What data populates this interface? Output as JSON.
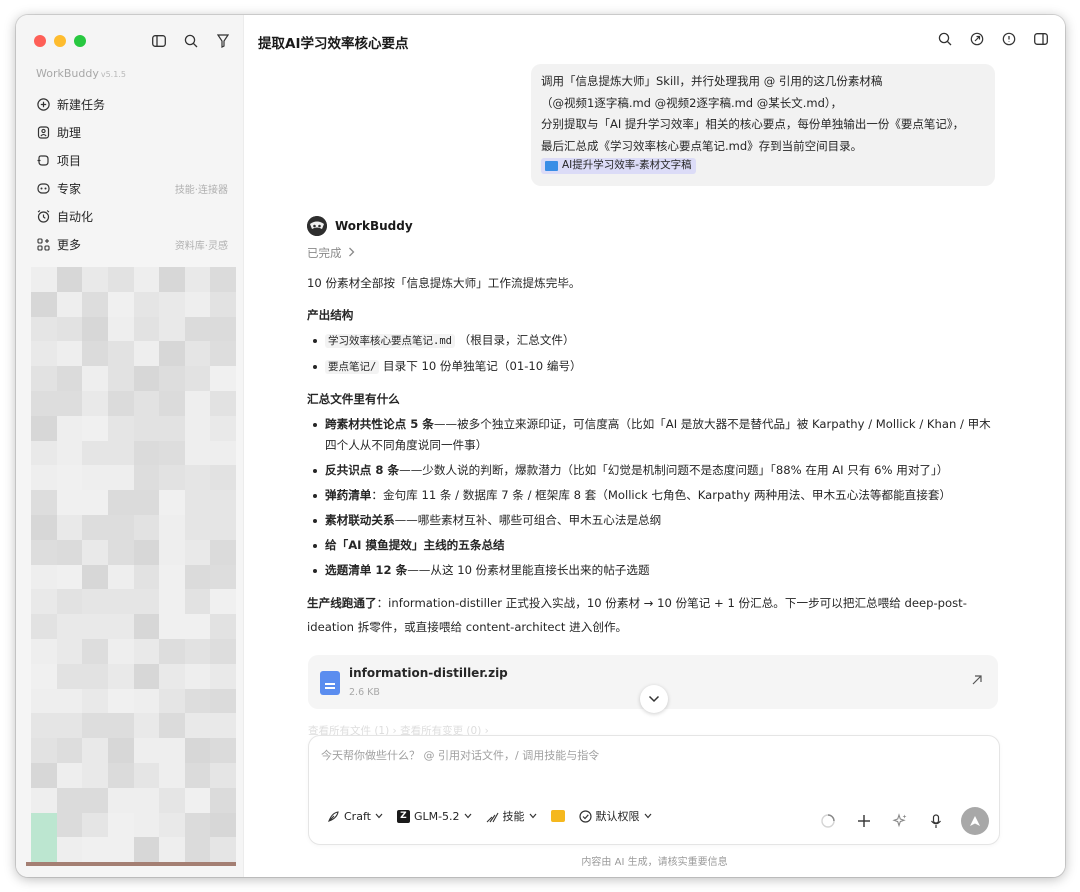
{
  "sidebar": {
    "app_name": "WorkBuddy",
    "version": "v5.1.5",
    "items": [
      {
        "label": "新建任务",
        "hint": "",
        "icon": "plus-circle-icon"
      },
      {
        "label": "助理",
        "hint": "",
        "icon": "assistant-icon"
      },
      {
        "label": "项目",
        "hint": "",
        "icon": "project-icon"
      },
      {
        "label": "专家",
        "hint": "技能·连接器",
        "icon": "expert-icon"
      },
      {
        "label": "自动化",
        "hint": "",
        "icon": "clock-icon"
      },
      {
        "label": "更多",
        "hint": "资料库·灵感",
        "icon": "grid-plus-icon"
      }
    ]
  },
  "header": {
    "title": "提取AI学习效率核心要点"
  },
  "user_message": {
    "line1": "调用「信息提炼大师」Skill，并行处理我用 @ 引用的这几份素材稿",
    "line2": "（@视频1逐字稿.md @视频2逐字稿.md @某长文.md），",
    "line3": "分别提取与「AI 提升学习效率」相关的核心要点，每份单独输出一份《要点笔记》，",
    "line4": "最后汇总成《学习效率核心要点笔记.md》存到当前空间目录。",
    "attachment": "AI提升学习效率-素材文字稿"
  },
  "reply": {
    "bot_name": "WorkBuddy",
    "status": "已完成",
    "intro": "10 份素材全部按「信息提炼大师」工作流提炼完毕。",
    "section1_title": "产出结构",
    "outputs": [
      {
        "code": "学习效率核心要点笔记.md",
        "text": "（根目录，汇总文件）"
      },
      {
        "code": "要点笔记/",
        "text": "目录下 10 份单独笔记（01-10 编号）"
      }
    ],
    "section2_title": "汇总文件里有什么",
    "summary": [
      {
        "bold": "跨素材共性论点 5 条",
        "text": "——被多个独立来源印证，可信度高（比如「AI 是放大器不是替代品」被 Karpathy / Mollick / Khan / 甲木四个人从不同角度说同一件事）"
      },
      {
        "bold": "反共识点 8 条",
        "text": "——少数人说的判断，爆款潜力（比如「幻觉是机制问题不是态度问题」「88% 在用 AI 只有 6% 用对了」）"
      },
      {
        "bold": "弹药清单",
        "text": "：金句库 11 条 / 数据库 7 条 / 框架库 8 套（Mollick 七角色、Karpathy 两种用法、甲木五心法等都能直接套）"
      },
      {
        "bold": "素材联动关系",
        "text": "——哪些素材互补、哪些可组合、甲木五心法是总纲"
      },
      {
        "bold": "给「AI 摸鱼提效」主线的五条总结",
        "text": ""
      },
      {
        "bold": "选题清单 12 条",
        "text": "——从这 10 份素材里能直接长出来的帖子选题"
      }
    ],
    "closing_bold": "生产线跑通了",
    "closing_text": "：information-distiller 正式投入实战，10 份素材 → 10 份笔记 + 1 份汇总。下一步可以把汇总喂给 deep-post-ideation 拆零件，或直接喂给 content-architect 进入创作。"
  },
  "file": {
    "name": "information-distiller.zip",
    "size": "2.6 KB"
  },
  "faded_text": "查看所有文件 (1) ›    查看所有变更 (0) ›",
  "composer": {
    "placeholder": "今天帮你做些什么？ @ 引用对话文件，/ 调用技能与指令",
    "mode": "Craft",
    "model": "GLM-5.2",
    "skills": "技能",
    "permission": "默认权限"
  },
  "footer": "内容由 AI 生成，请核实重要信息",
  "colors": {
    "accent_chip": "#dcdcf7",
    "folder": "#3a8ee6",
    "file_icon": "#5b8def"
  }
}
